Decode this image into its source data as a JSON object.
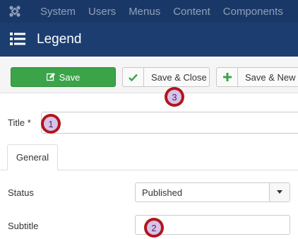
{
  "topnav": {
    "logo_icon": "joomla-logo-icon",
    "items": [
      "System",
      "Users",
      "Menus",
      "Content",
      "Components"
    ]
  },
  "header": {
    "icon": "list-icon",
    "title": "Legend"
  },
  "toolbar": {
    "save_label": "Save",
    "save_icon": "edit-icon",
    "save_close_label": "Save & Close",
    "save_close_icon": "checkmark-icon",
    "save_new_label": "Save & New",
    "save_new_icon": "plus-icon"
  },
  "form": {
    "title_label": "Title *",
    "title_value": "",
    "tab_general": "General",
    "status_label": "Status",
    "status_value": "Published",
    "subtitle_label": "Subtitle",
    "subtitle_value": ""
  },
  "markers": [
    "1",
    "2",
    "3"
  ],
  "colors": {
    "nav_bg": "#1a3867",
    "header_bg": "#1c3d70",
    "save_green": "#3ba449",
    "marker_red": "#b0161c"
  }
}
